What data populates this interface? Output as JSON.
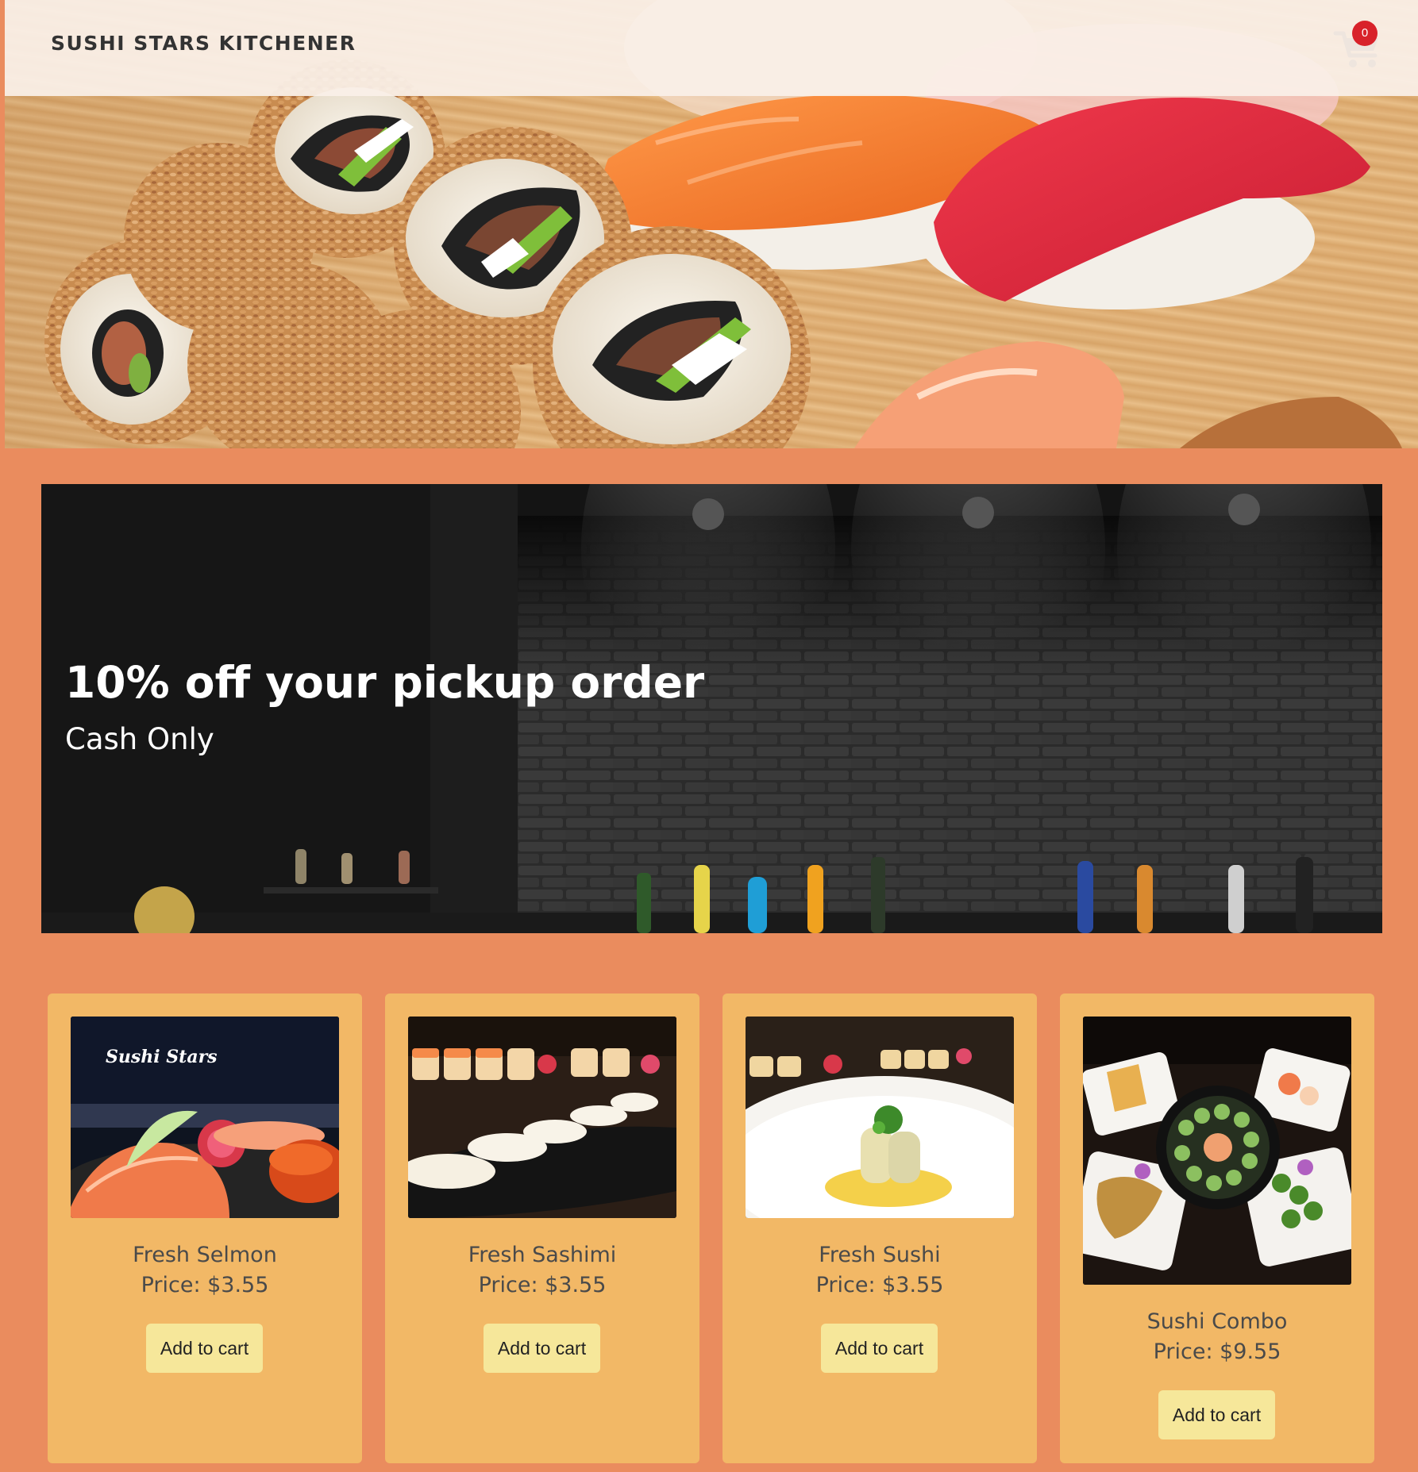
{
  "navbar": {
    "brand": "SUSHI STARS KITCHENER",
    "cart_count": "0",
    "cart_icon": "shopping-cart-icon"
  },
  "promo": {
    "title": "10% off your pickup order",
    "subtitle": "Cash Only"
  },
  "products": [
    {
      "name": "Fresh Selmon",
      "price_label": "Price: $3.55",
      "button_label": "Add to cart",
      "image_sign": "Sushi Stars"
    },
    {
      "name": "Fresh Sashimi",
      "price_label": "Price: $3.55",
      "button_label": "Add to cart"
    },
    {
      "name": "Fresh Sushi",
      "price_label": "Price: $3.55",
      "button_label": "Add to cart"
    },
    {
      "name": "Sushi Combo",
      "price_label": "Price: $9.55",
      "button_label": "Add to cart"
    }
  ],
  "colors": {
    "page_background": "#ea8c5e",
    "card_background": "#f2b866",
    "button_background": "#f6e79a",
    "badge_red": "#d8222a",
    "navbar_background": "#faf0e8"
  }
}
